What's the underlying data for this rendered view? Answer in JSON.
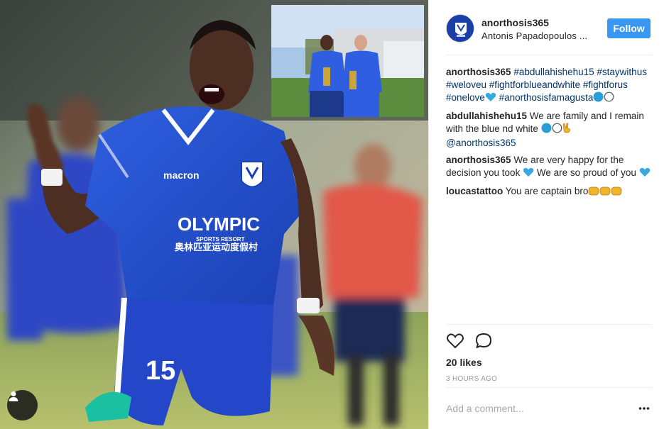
{
  "post": {
    "username": "anorthosis365",
    "location": "Antonis Papadopoulos ...",
    "follow_label": "Follow",
    "photo_text": {
      "brand": "macron",
      "sponsor": "OLYMPIC",
      "sponsor_sub": "SPORTS RESORT",
      "sponsor_chinese": "奥林匹亚运动度假村",
      "number": "15"
    }
  },
  "comments": [
    {
      "user": "anorthosis365",
      "text": "#abdullahishehu15 #staywithus #weloveu #fightforblueandwhite #fightforus #onelove",
      "text2": " #anorthosisfamagusta"
    },
    {
      "user": "abdullahishehu15",
      "text": "We are family and I remain with the blue nd white ",
      "mention": "@anorthosis365"
    },
    {
      "user": "anorthosis365",
      "text": "We are very happy for the decision you took ",
      "text2": " We are so proud of you "
    },
    {
      "user": "loucastattoo",
      "text": "You are captain bro"
    }
  ],
  "stats": {
    "likes": "20 likes",
    "time": "3 HOURS AGO"
  },
  "add_comment": {
    "placeholder": "Add a comment..."
  },
  "icons": {
    "like": "heart-icon",
    "comment": "speech-bubble-icon",
    "more": "more-options-icon",
    "tagged": "person-icon"
  },
  "colors": {
    "follow_bg": "#3897f0",
    "link": "#003569",
    "heart_emoji": "#36a9e1",
    "blue_circle": "#2b9ed8"
  }
}
